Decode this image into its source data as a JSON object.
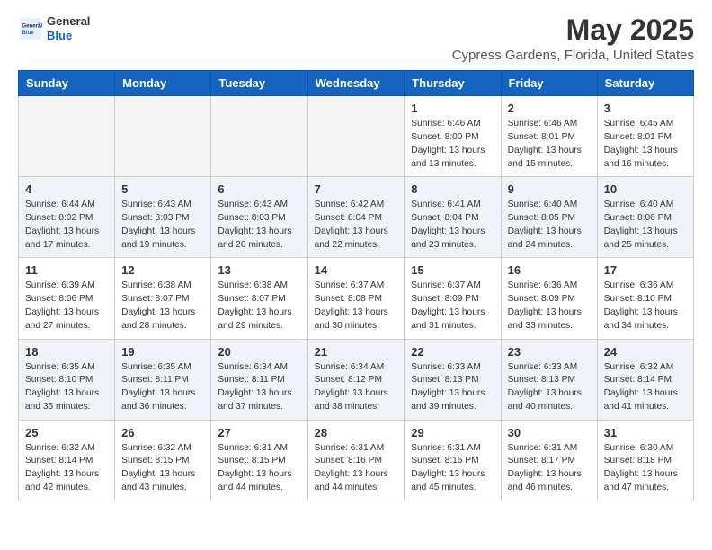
{
  "header": {
    "logo_general": "General",
    "logo_blue": "Blue",
    "title": "May 2025",
    "subtitle": "Cypress Gardens, Florida, United States"
  },
  "days_of_week": [
    "Sunday",
    "Monday",
    "Tuesday",
    "Wednesday",
    "Thursday",
    "Friday",
    "Saturday"
  ],
  "weeks": [
    [
      {
        "day": "",
        "empty": true
      },
      {
        "day": "",
        "empty": true
      },
      {
        "day": "",
        "empty": true
      },
      {
        "day": "",
        "empty": true
      },
      {
        "day": "1",
        "sunrise": "6:46 AM",
        "sunset": "8:00 PM",
        "daylight": "13 hours and 13 minutes."
      },
      {
        "day": "2",
        "sunrise": "6:46 AM",
        "sunset": "8:01 PM",
        "daylight": "13 hours and 15 minutes."
      },
      {
        "day": "3",
        "sunrise": "6:45 AM",
        "sunset": "8:01 PM",
        "daylight": "13 hours and 16 minutes."
      }
    ],
    [
      {
        "day": "4",
        "sunrise": "6:44 AM",
        "sunset": "8:02 PM",
        "daylight": "13 hours and 17 minutes."
      },
      {
        "day": "5",
        "sunrise": "6:43 AM",
        "sunset": "8:03 PM",
        "daylight": "13 hours and 19 minutes."
      },
      {
        "day": "6",
        "sunrise": "6:43 AM",
        "sunset": "8:03 PM",
        "daylight": "13 hours and 20 minutes."
      },
      {
        "day": "7",
        "sunrise": "6:42 AM",
        "sunset": "8:04 PM",
        "daylight": "13 hours and 22 minutes."
      },
      {
        "day": "8",
        "sunrise": "6:41 AM",
        "sunset": "8:04 PM",
        "daylight": "13 hours and 23 minutes."
      },
      {
        "day": "9",
        "sunrise": "6:40 AM",
        "sunset": "8:05 PM",
        "daylight": "13 hours and 24 minutes."
      },
      {
        "day": "10",
        "sunrise": "6:40 AM",
        "sunset": "8:06 PM",
        "daylight": "13 hours and 25 minutes."
      }
    ],
    [
      {
        "day": "11",
        "sunrise": "6:39 AM",
        "sunset": "8:06 PM",
        "daylight": "13 hours and 27 minutes."
      },
      {
        "day": "12",
        "sunrise": "6:38 AM",
        "sunset": "8:07 PM",
        "daylight": "13 hours and 28 minutes."
      },
      {
        "day": "13",
        "sunrise": "6:38 AM",
        "sunset": "8:07 PM",
        "daylight": "13 hours and 29 minutes."
      },
      {
        "day": "14",
        "sunrise": "6:37 AM",
        "sunset": "8:08 PM",
        "daylight": "13 hours and 30 minutes."
      },
      {
        "day": "15",
        "sunrise": "6:37 AM",
        "sunset": "8:09 PM",
        "daylight": "13 hours and 31 minutes."
      },
      {
        "day": "16",
        "sunrise": "6:36 AM",
        "sunset": "8:09 PM",
        "daylight": "13 hours and 33 minutes."
      },
      {
        "day": "17",
        "sunrise": "6:36 AM",
        "sunset": "8:10 PM",
        "daylight": "13 hours and 34 minutes."
      }
    ],
    [
      {
        "day": "18",
        "sunrise": "6:35 AM",
        "sunset": "8:10 PM",
        "daylight": "13 hours and 35 minutes."
      },
      {
        "day": "19",
        "sunrise": "6:35 AM",
        "sunset": "8:11 PM",
        "daylight": "13 hours and 36 minutes."
      },
      {
        "day": "20",
        "sunrise": "6:34 AM",
        "sunset": "8:11 PM",
        "daylight": "13 hours and 37 minutes."
      },
      {
        "day": "21",
        "sunrise": "6:34 AM",
        "sunset": "8:12 PM",
        "daylight": "13 hours and 38 minutes."
      },
      {
        "day": "22",
        "sunrise": "6:33 AM",
        "sunset": "8:13 PM",
        "daylight": "13 hours and 39 minutes."
      },
      {
        "day": "23",
        "sunrise": "6:33 AM",
        "sunset": "8:13 PM",
        "daylight": "13 hours and 40 minutes."
      },
      {
        "day": "24",
        "sunrise": "6:32 AM",
        "sunset": "8:14 PM",
        "daylight": "13 hours and 41 minutes."
      }
    ],
    [
      {
        "day": "25",
        "sunrise": "6:32 AM",
        "sunset": "8:14 PM",
        "daylight": "13 hours and 42 minutes."
      },
      {
        "day": "26",
        "sunrise": "6:32 AM",
        "sunset": "8:15 PM",
        "daylight": "13 hours and 43 minutes."
      },
      {
        "day": "27",
        "sunrise": "6:31 AM",
        "sunset": "8:15 PM",
        "daylight": "13 hours and 44 minutes."
      },
      {
        "day": "28",
        "sunrise": "6:31 AM",
        "sunset": "8:16 PM",
        "daylight": "13 hours and 44 minutes."
      },
      {
        "day": "29",
        "sunrise": "6:31 AM",
        "sunset": "8:16 PM",
        "daylight": "13 hours and 45 minutes."
      },
      {
        "day": "30",
        "sunrise": "6:31 AM",
        "sunset": "8:17 PM",
        "daylight": "13 hours and 46 minutes."
      },
      {
        "day": "31",
        "sunrise": "6:30 AM",
        "sunset": "8:18 PM",
        "daylight": "13 hours and 47 minutes."
      }
    ]
  ],
  "labels": {
    "sunrise": "Sunrise:",
    "sunset": "Sunset:",
    "daylight": "Daylight:"
  }
}
